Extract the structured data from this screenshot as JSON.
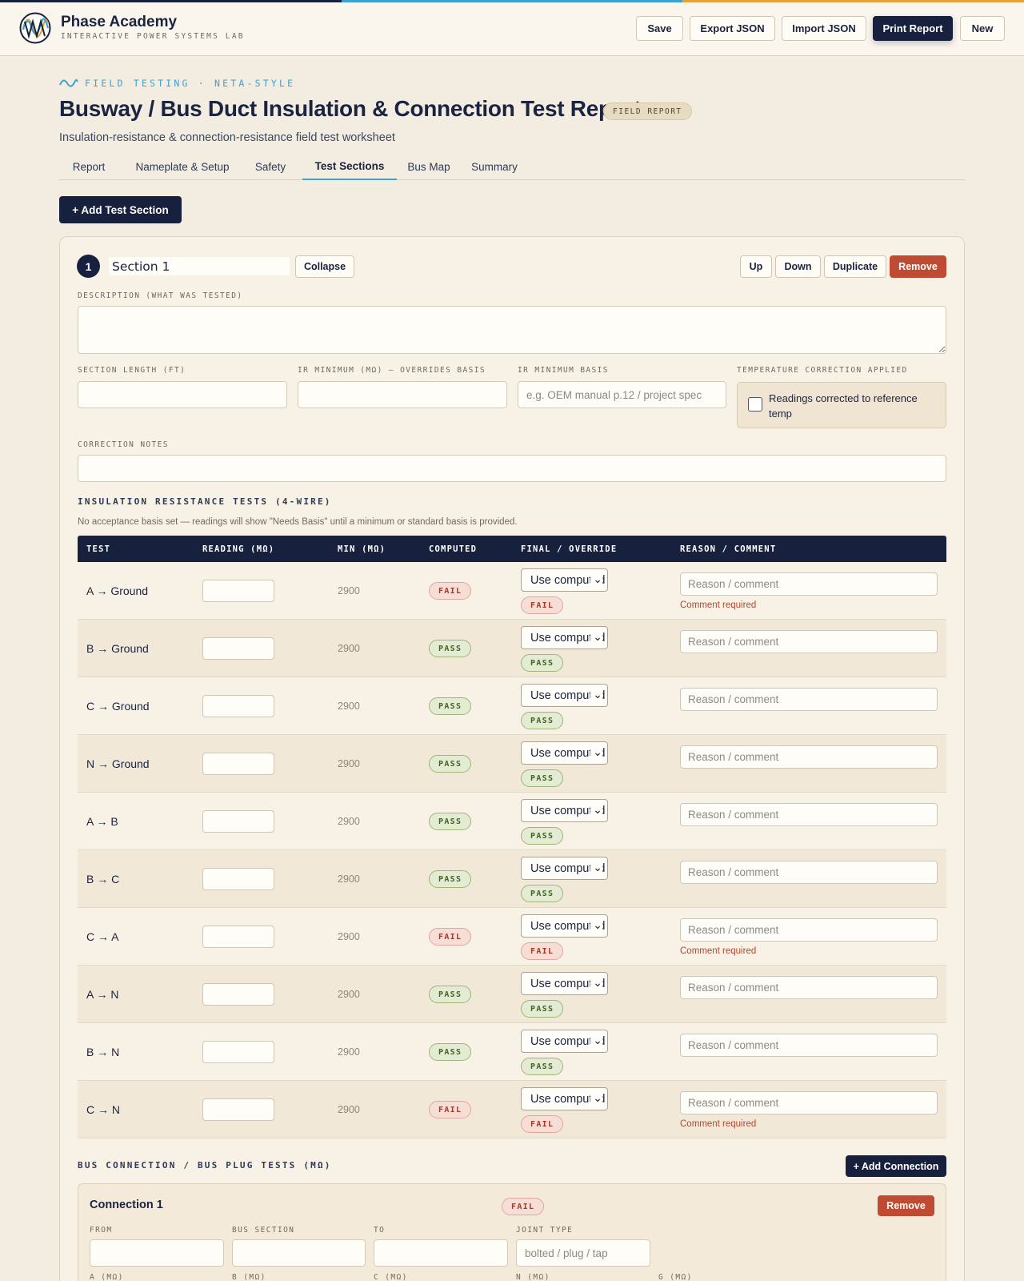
{
  "colors": {
    "navy": "#17213d",
    "accent_blue": "#3aa3d6",
    "accent_orange": "#e8a13a",
    "danger": "#bf4b33",
    "pass": "#45612a",
    "fail": "#a33a27"
  },
  "brand": {
    "name": "Phase Academy",
    "subtitle": "INTERACTIVE POWER SYSTEMS LAB",
    "logo_icon": "phase-wave-logo"
  },
  "header_actions": {
    "save": "Save",
    "export": "Export JSON",
    "import": "Import JSON",
    "print": "Print Report",
    "new": "New"
  },
  "page": {
    "kicker": "FIELD TESTING · NETA-STYLE",
    "title": "Busway / Bus Duct Insulation & Connection Test Report",
    "badge": "FIELD REPORT",
    "subtitle": "Insulation-resistance & connection-resistance field test worksheet"
  },
  "tabs": [
    {
      "label": "Report"
    },
    {
      "label": "Nameplate & Setup"
    },
    {
      "label": "Safety"
    },
    {
      "label": "Test Sections",
      "active": true
    },
    {
      "label": "Bus Map"
    },
    {
      "label": "Summary"
    }
  ],
  "add_section_label": "+ Add Test Section",
  "section": {
    "number": "1",
    "name": "Section 1",
    "collapse": "Collapse",
    "up": "Up",
    "down": "Down",
    "duplicate": "Duplicate",
    "remove": "Remove",
    "description_label": "DESCRIPTION (WHAT WAS TESTED)",
    "length_label": "SECTION LENGTH (FT)",
    "ir_min_label": "IR MINIMUM (MΩ) — OVERRIDES BASIS",
    "ir_basis_label": "IR MINIMUM BASIS",
    "ir_basis_placeholder": "e.g. OEM manual p.12 / project spec",
    "temp_label": "TEMPERATURE CORRECTION APPLIED",
    "temp_checkbox": "Readings corrected to reference temp",
    "correction_label": "CORRECTION NOTES"
  },
  "ir_tests": {
    "heading": "INSULATION RESISTANCE TESTS (4-WIRE)",
    "note": "No acceptance basis set — readings will show \"Needs Basis\" until a minimum or standard basis is provided.",
    "columns": [
      "TEST",
      "READING (MΩ)",
      "MIN (MΩ)",
      "COMPUTED",
      "FINAL / OVERRIDE",
      "REASON / COMMENT"
    ],
    "select_value": "Use computed",
    "reason_placeholder": "Reason / comment",
    "comment_required": "Comment required",
    "rows": [
      {
        "test": "A → Ground",
        "min": "2900",
        "computed": "FAIL",
        "final": "FAIL"
      },
      {
        "test": "B → Ground",
        "min": "2900",
        "computed": "PASS",
        "final": "PASS"
      },
      {
        "test": "C → Ground",
        "min": "2900",
        "computed": "PASS",
        "final": "PASS"
      },
      {
        "test": "N → Ground",
        "min": "2900",
        "computed": "PASS",
        "final": "PASS"
      },
      {
        "test": "A → B",
        "min": "2900",
        "computed": "PASS",
        "final": "PASS"
      },
      {
        "test": "B → C",
        "min": "2900",
        "computed": "PASS",
        "final": "PASS"
      },
      {
        "test": "C → A",
        "min": "2900",
        "computed": "FAIL",
        "final": "FAIL"
      },
      {
        "test": "A → N",
        "min": "2900",
        "computed": "PASS",
        "final": "PASS"
      },
      {
        "test": "B → N",
        "min": "2900",
        "computed": "PASS",
        "final": "PASS"
      },
      {
        "test": "C → N",
        "min": "2900",
        "computed": "FAIL",
        "final": "FAIL"
      }
    ]
  },
  "connections": {
    "heading": "BUS CONNECTION / BUS PLUG TESTS (MΩ)",
    "add_label": "+ Add Connection",
    "items": [
      {
        "title": "Connection 1",
        "status": "FAIL",
        "remove": "Remove",
        "fields": [
          {
            "label": "FROM",
            "placeholder": ""
          },
          {
            "label": "BUS SECTION",
            "placeholder": ""
          },
          {
            "label": "TO",
            "placeholder": ""
          },
          {
            "label": "JOINT TYPE",
            "placeholder": "bolted / plug / tap"
          }
        ],
        "phase_labels": [
          "A (MΩ)",
          "B (MΩ)",
          "C (MΩ)",
          "N (MΩ)",
          "G (MΩ)"
        ]
      }
    ]
  }
}
